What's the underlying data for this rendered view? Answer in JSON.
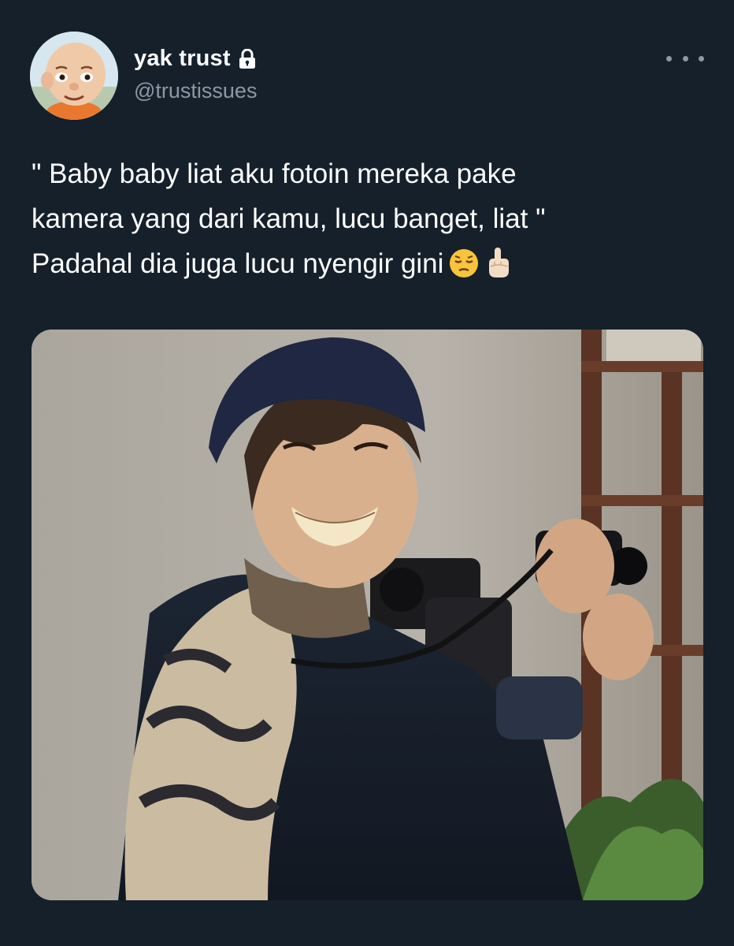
{
  "user": {
    "display_name": "yak trust",
    "handle": "@trustissues",
    "avatar_icon": "cartoon-avatar-icon",
    "protected_icon": "lock-icon"
  },
  "tweet": {
    "lines": [
      "\" Baby baby liat aku fotoin mereka pake",
      "kamera yang dari kamu, lucu banget, liat \"",
      "Padahal dia juga lucu nyengir gini"
    ],
    "emojis": [
      "pensive-face-emoji",
      "index-pointing-up-emoji"
    ]
  },
  "media": {
    "kind": "photo",
    "description_icon": "photo-person-with-camera"
  },
  "colors": {
    "background": "#15202b",
    "primary_text": "#ffffff",
    "secondary_text": "#8b98a5"
  }
}
